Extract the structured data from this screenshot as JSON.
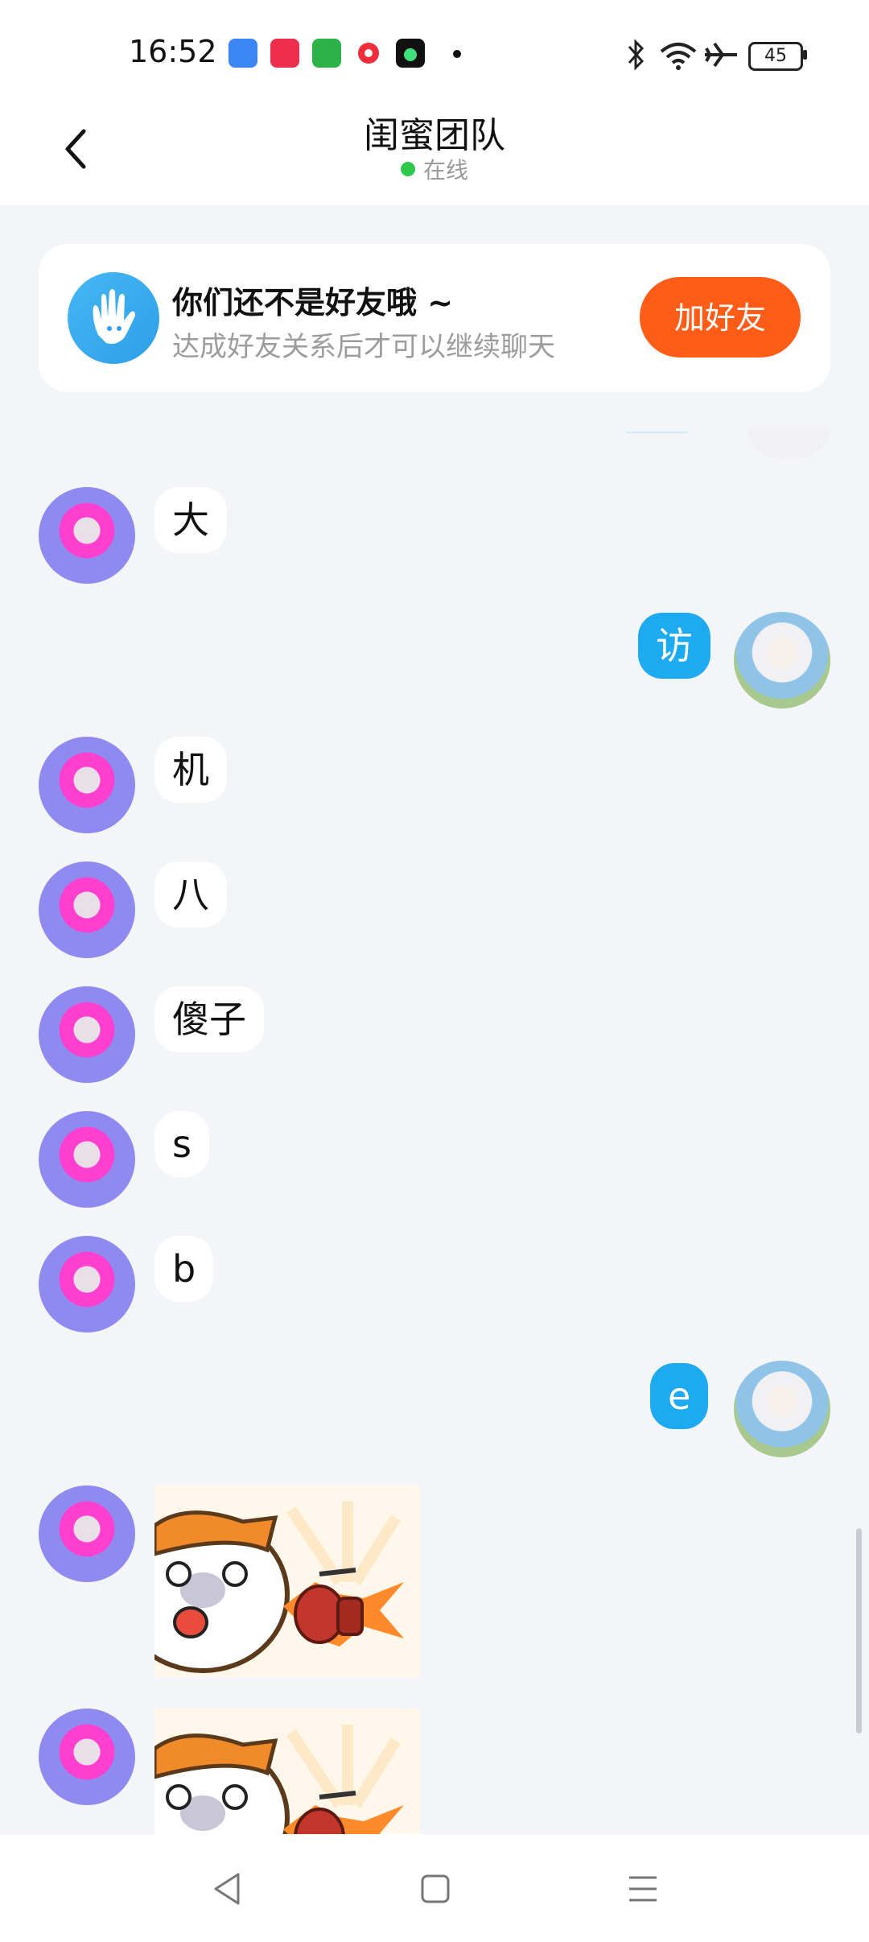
{
  "status_bar": {
    "time": "16:52",
    "battery": "45",
    "icons": [
      "app-blue-icon",
      "video-red-icon",
      "shop-green-icon",
      "music-red-icon",
      "music-black-icon",
      "bluetooth-icon",
      "wifi-icon",
      "airplane-icon",
      "battery-icon"
    ]
  },
  "header": {
    "title": "闺蜜团队",
    "status": "在线"
  },
  "banner": {
    "title": "你们还不是好友哦 ~",
    "subtitle": "达成好友关系后才可以继续聊天",
    "button": "加好友"
  },
  "messages": [
    {
      "side": "left",
      "text": "大"
    },
    {
      "side": "right",
      "text": "访"
    },
    {
      "side": "left",
      "text": "机"
    },
    {
      "side": "left",
      "text": "八"
    },
    {
      "side": "left",
      "text": "傻子"
    },
    {
      "side": "left",
      "text": "s"
    },
    {
      "side": "left",
      "text": "b"
    },
    {
      "side": "right",
      "text": "e"
    },
    {
      "side": "left",
      "type": "sticker"
    },
    {
      "side": "left",
      "type": "sticker"
    }
  ],
  "colors": {
    "accent_orange": "#ff5c17",
    "bubble_blue": "#1daaf0",
    "online_green": "#2ec84a",
    "background": "#f3f5f8"
  },
  "nav_bar": [
    "back-nav-icon",
    "home-nav-icon",
    "menu-nav-icon"
  ]
}
